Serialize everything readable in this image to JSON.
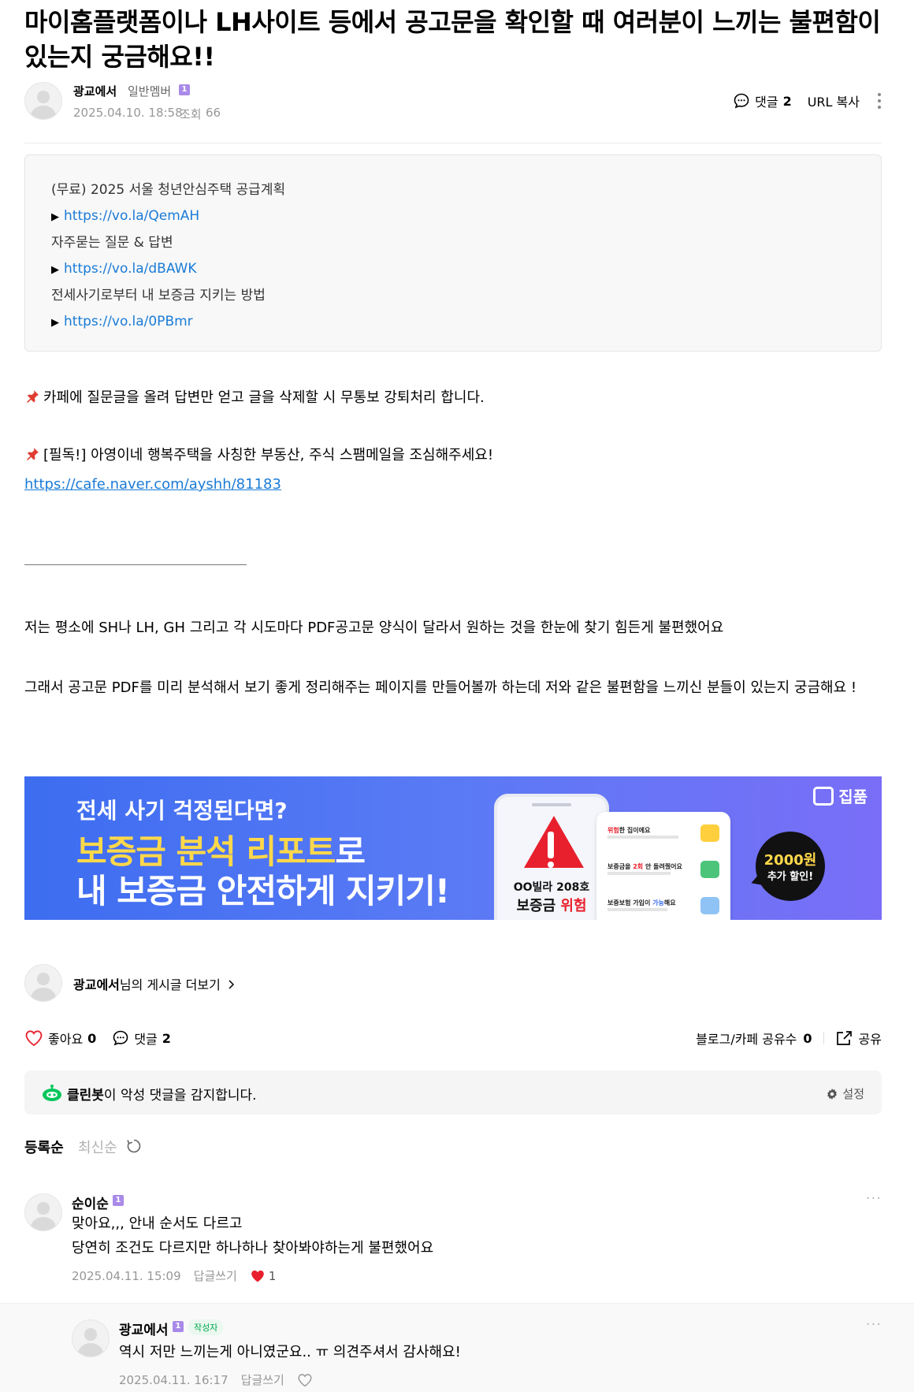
{
  "post": {
    "title": "마이홈플랫폼이나 LH사이트 등에서 공고문을 확인할 때 여러분이 느끼는 불편함이 있는지 궁금해요!!",
    "author": "광교에서",
    "member_level": "일반멤버",
    "level_badge": "1",
    "date": "2025.04.10. 18:58",
    "views_label": "조회",
    "views": "66",
    "comment_label": "댓글",
    "comment_count": "2",
    "url_copy": "URL 복사"
  },
  "info_box": {
    "line1": "(무료) 2025 서울 청년안심주택 공급계획",
    "link1": "https://vo.la/QemAH",
    "line2": "자주묻는 질문 & 답변",
    "link2": "https://vo.la/dBAWK",
    "line3": "전세사기로부터 내 보증금 지키는 방법",
    "link3": "https://vo.la/0PBmr",
    "bullet": "▶"
  },
  "body": {
    "notice1": "카페에 질문글을 올려 답변만 얻고 글을 삭제할 시 무통보 강퇴처리 합니다.",
    "notice2": "[필독!] 아영이네 행복주택을 사칭한 부동산, 주식 스팸메일을 조심해주세요!",
    "notice2_link": "https://cafe.naver.com/ayshh/81183",
    "para1": "저는 평소에 SH나 LH, GH 그리고 각 시도마다 PDF공고문 양식이 달라서 원하는 것을 한눈에 찾기 힘든게 불편했어요",
    "para2": "그래서 공고문 PDF를 미리 분석해서 보기 좋게 정리해주는 페이지를 만들어볼까 하는데 저와 같은 불편함을 느끼신 분들이 있는지 궁금해요 !"
  },
  "banner": {
    "question": "전세 사기 걱정된다면?",
    "line1_highlight": "보증금 분석 리포트",
    "line1_rest": "로",
    "line2": "내 보증금 안전하게 지키기!",
    "brand": "집품",
    "phone_name": "OO빌라 208호",
    "phone_risk_prefix": "보증금 ",
    "phone_risk": "위험",
    "card_row1_red": "위험",
    "card_row1": "한 집이에요",
    "card_row2_prefix": "보증금을 ",
    "card_row2_red": "2회",
    "card_row2": " 안 돌려줬어요",
    "card_row3_prefix": "보증보험 가입이 ",
    "card_row3_red": "가능",
    "card_row3": "해요",
    "sale_amount": "2000원",
    "sale_text": "추가 할인!"
  },
  "more_posts": {
    "author": "광교에서",
    "suffix": "님의 게시글 더보기"
  },
  "actions": {
    "like_label": "좋아요",
    "like_count": "0",
    "comment_label": "댓글",
    "comment_count": "2",
    "share_count_label": "블로그/카페 공유수",
    "share_count": "0",
    "share_label": "공유"
  },
  "cleanbot": {
    "name": "클린봇",
    "text": "이 악성 댓글을 감지합니다.",
    "settings": "설정"
  },
  "sort": {
    "registered": "등록순",
    "latest": "최신순"
  },
  "comments": [
    {
      "name": "순이순",
      "badge": "1",
      "line1": "맞아요,,, 안내 순서도 다르고",
      "line2": "당연히 조건도 다르지만 하나하나 찾아봐야하는게 불편했어요",
      "date": "2025.04.11. 15:09",
      "reply": "답글쓰기",
      "likes": "1"
    },
    {
      "name": "광교에서",
      "badge": "1",
      "tag": "작성자",
      "line1": "역시 저만 느끼는게 아니였군요.. ㅠ 의견주셔서 감사해요!",
      "date": "2025.04.11. 16:17",
      "reply": "답글쓰기"
    }
  ],
  "colors": {
    "link": "#1a7bd6",
    "like_heart": "#e8202d",
    "author_tag": "#03a94f",
    "level_badge": "#a98ae8"
  }
}
